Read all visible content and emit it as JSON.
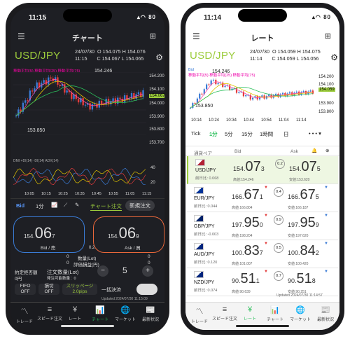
{
  "left": {
    "status": {
      "time": "11:15",
      "icons": "▴◠ 80"
    },
    "title": "チャート",
    "pair": "USD/JPY",
    "ohlc": {
      "date": "24/07/30",
      "time": "11:15",
      "o": "O 154.075",
      "h": "H 154.076",
      "c": "C 154.067",
      "l": "L 154.065"
    },
    "ma_labels": "移動平均(5)  移動平均(25)  移動平均(75)",
    "price_axis": [
      "154.200",
      "154.100",
      "154.067",
      "154.000",
      "153.900",
      "153.800",
      "153.700"
    ],
    "chart_hi": "154.246",
    "chart_lo": "153.850",
    "dmi": "DMI  +DI(14)  -DI(14)  ADX(14)",
    "dmi_axis": [
      "40",
      "20"
    ],
    "time_axis": [
      "10:05",
      "10:15",
      "10:25",
      "10:35",
      "10:45",
      "10:55",
      "11:05",
      "11:15"
    ],
    "chart_data": {
      "type": "line",
      "x": [
        "10:05",
        "10:15",
        "10:25",
        "10:35",
        "10:45",
        "10:55",
        "11:05",
        "11:15"
      ],
      "series": [
        {
          "name": "USD/JPY",
          "values": [
            153.87,
            154.12,
            154.2,
            154.05,
            153.95,
            153.99,
            154.02,
            154.07
          ]
        }
      ],
      "ylim": [
        153.7,
        154.25
      ]
    },
    "toolbar": {
      "bid": "Bid",
      "tf": "1分",
      "btn_chart": "チャート注文",
      "btn_new": "新規注文"
    },
    "bid": {
      "pre": "154.",
      "big": "06",
      "small": "7",
      "label": "Bid / 売"
    },
    "spread": "0.2",
    "ask": {
      "pre": "154.",
      "big": "06",
      "small": "9",
      "label": "Ask / 買"
    },
    "qty_row": {
      "left": "0",
      "mid": "数量(Lot)",
      "right": "0"
    },
    "pl_row": {
      "left": "0",
      "mid": "評価損益(円)",
      "right": "0"
    },
    "order": {
      "label1": "約定拒否額",
      "val1": "0円",
      "label2": "注文数量(Lot)",
      "label3": "発注可能数量：0",
      "qty": "5",
      "minus": "−",
      "plus": "+"
    },
    "fifo": {
      "fifo": "FIFO",
      "fifo_v": "OFF",
      "stop": "損切",
      "stop_v": "OFF",
      "slip": "スリッページ",
      "slip_v": "2.0pips",
      "bulk": "一括決済"
    },
    "updated": "Updated  2024/07/30 11:15:09",
    "nav": [
      "トレード",
      "スピード注文",
      "レート",
      "チャート",
      "マーケット",
      "最新状況"
    ]
  },
  "right": {
    "status": {
      "time": "11:14",
      "icons": "▴◠ 80"
    },
    "title": "レート",
    "pair": "USD/JPY",
    "ohlc": {
      "date": "24/07/30",
      "time": "11:14",
      "o": "O 154.059",
      "h": "H 154.075",
      "c": "C 154.059",
      "l": "L 154.056"
    },
    "bid_label": "Bid",
    "ma_labels": "移動平均(5)  移動平均(25)  移動平均(75)",
    "price_axis": [
      "154.200",
      "154.100",
      "154.059",
      "153.900",
      "153.800"
    ],
    "chart_hi": "154.246",
    "chart_lo": "153.850",
    "time_axis": [
      "10:14",
      "10:24",
      "10:34",
      "10:44",
      "10:54",
      "11:04",
      "11:14"
    ],
    "chart_data": {
      "type": "line",
      "x": [
        "10:14",
        "10:24",
        "10:34",
        "10:44",
        "10:54",
        "11:04",
        "11:14"
      ],
      "series": [
        {
          "name": "USD/JPY",
          "values": [
            153.86,
            154.2,
            154.1,
            153.98,
            154.01,
            154.04,
            154.06
          ]
        }
      ],
      "ylim": [
        153.8,
        154.25
      ]
    },
    "tabs": [
      "Tick",
      "1分",
      "5分",
      "15分",
      "1時間",
      "日",
      "• • • ▾"
    ],
    "cols": {
      "pair": "通貨ペア",
      "bid": "Bid",
      "ask": "Ask"
    },
    "rates": [
      {
        "name": "USD/JPY",
        "ch": "前日比: 0.068",
        "bid_pre": "154.",
        "bid_big": "07",
        "bid_s": "3",
        "ask_pre": "154.",
        "ask_big": "07",
        "ask_s": "5",
        "sp": "0.2",
        "bh": "高値:154.246",
        "al": "安値:153.620",
        "hl": true
      },
      {
        "name": "EUR/JPY",
        "ch": "前日比: 0.044",
        "bid_pre": "166.",
        "bid_big": "67",
        "bid_s": "1",
        "ask_pre": "166.",
        "ask_big": "67",
        "ask_s": "5",
        "sp": "0.4",
        "bh": "高値:166.804",
        "al": "安値:166.187"
      },
      {
        "name": "GBP/JPY",
        "ch": "前日比: -0.003",
        "bid_pre": "197.",
        "bid_big": "95",
        "bid_s": "0",
        "ask_pre": "197.",
        "ask_big": "95",
        "ask_s": "9",
        "sp": "0.9",
        "bh": "高値:198.204",
        "al": "安値:197.620"
      },
      {
        "name": "AUD/JPY",
        "ch": "前日比: 0.120",
        "bid_pre": "100.",
        "bid_big": "83",
        "bid_s": "7",
        "ask_pre": "100.",
        "ask_big": "84",
        "ask_s": "2",
        "sp": "0.5",
        "bh": "高値:101.007",
        "al": "安値:100.420"
      },
      {
        "name": "NZD/JPY",
        "ch": "前日比: 0.074",
        "bid_pre": "90.",
        "bid_big": "51",
        "bid_s": "1",
        "ask_pre": "90.",
        "ask_big": "51",
        "ask_s": "8",
        "sp": "0.7",
        "bh": "高値:90.639",
        "al": "安値:90.251"
      }
    ],
    "updated": "Updated  2024/07/30 11:14:57",
    "nav": [
      "トレード",
      "スピード注文",
      "レート",
      "チャート",
      "マーケット",
      "最新状況"
    ]
  },
  "colors": {
    "accent": "#9ccc3c",
    "bid": "#3a7bd5",
    "ask": "#e8673a",
    "up": "#3a7bd5",
    "down": "#e23b3b"
  }
}
